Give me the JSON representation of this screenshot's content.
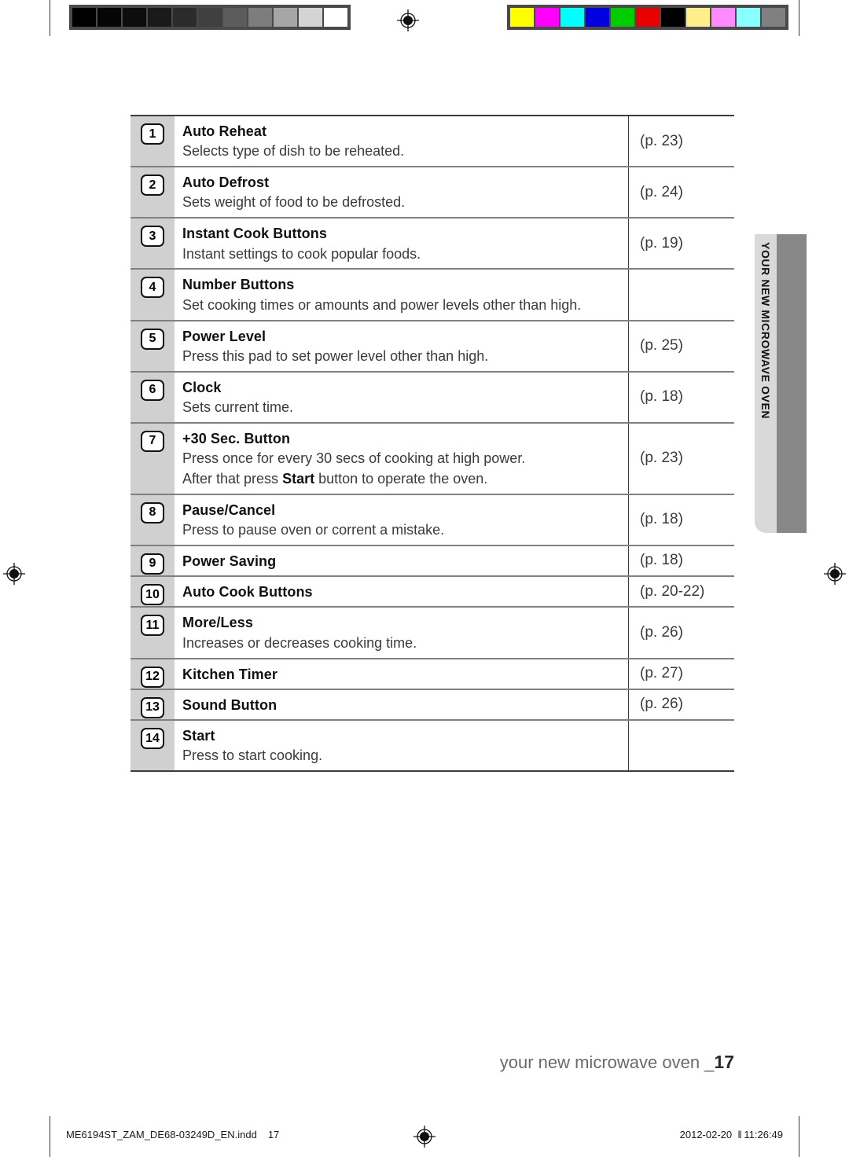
{
  "document": {
    "page_number": "17",
    "footer_label": "your new microwave oven _",
    "side_tab_label": "YOUR NEW MICROWAVE OVEN"
  },
  "print_marks": {
    "grayscale_wedge": [
      "#000000",
      "#050505",
      "#0d0d0d",
      "#1a1a1a",
      "#2b2b2b",
      "#404040",
      "#5c5c5c",
      "#7d7d7d",
      "#a6a6a6",
      "#d4d4d4",
      "#ffffff"
    ],
    "color_wedge": [
      "#ffff00",
      "#ff00ff",
      "#00ffff",
      "#0000e0",
      "#00cc00",
      "#e60000",
      "#000000",
      "#ffef8a",
      "#ff8aff",
      "#8affff",
      "#808080"
    ],
    "registration_icon": "registration-target-icon"
  },
  "table": {
    "rows": [
      {
        "number": "1",
        "title": "Auto Reheat",
        "description": "Selects type of dish to be reheated.",
        "description2": "",
        "page_ref": "(p. 23)"
      },
      {
        "number": "2",
        "title": "Auto Defrost",
        "description": "Sets weight of food to be defrosted.",
        "description2": "",
        "page_ref": "(p. 24)"
      },
      {
        "number": "3",
        "title": "Instant Cook Buttons",
        "description": "Instant settings to cook popular foods.",
        "description2": "",
        "page_ref": "(p. 19)"
      },
      {
        "number": "4",
        "title": "Number Buttons",
        "description": "Set cooking times or amounts and power levels other than high.",
        "description2": "",
        "page_ref": ""
      },
      {
        "number": "5",
        "title": "Power Level",
        "description": "Press this pad to set power level other than high.",
        "description2": "",
        "page_ref": "(p. 25)"
      },
      {
        "number": "6",
        "title": "Clock",
        "description": "Sets current time.",
        "description2": "",
        "page_ref": "(p. 18)"
      },
      {
        "number": "7",
        "title": "+30 Sec. Button",
        "description": "Press once for every 30 secs of cooking at high power.",
        "description2_prefix": "After that press ",
        "description2_bold": "Start",
        "description2_suffix": " button to operate the oven.",
        "page_ref": "(p. 23)"
      },
      {
        "number": "8",
        "title": "Pause/Cancel",
        "description": "Press to pause oven or corrent a mistake.",
        "description2": "",
        "page_ref": "(p. 18)"
      },
      {
        "number": "9",
        "title": "Power Saving",
        "description": "",
        "description2": "",
        "page_ref": "(p. 18)"
      },
      {
        "number": "10",
        "title": "Auto Cook Buttons",
        "description": "",
        "description2": "",
        "page_ref": "(p. 20-22)"
      },
      {
        "number": "11",
        "title": "More/Less",
        "description": "Increases or decreases cooking time.",
        "description2": "",
        "page_ref": "(p. 26)"
      },
      {
        "number": "12",
        "title": "Kitchen Timer",
        "description": "",
        "description2": "",
        "page_ref": "(p. 27)"
      },
      {
        "number": "13",
        "title": "Sound Button",
        "description": "",
        "description2": "",
        "page_ref": "(p. 26)"
      },
      {
        "number": "14",
        "title": "Start",
        "description": "Press to start cooking.",
        "description2": "",
        "page_ref": ""
      }
    ]
  },
  "print_footer": {
    "filename": "ME6194ST_ZAM_DE68-03249D_EN.indd",
    "page": "17",
    "date": "2012-02-20",
    "separator": "‖",
    "time": "11:26:49"
  }
}
